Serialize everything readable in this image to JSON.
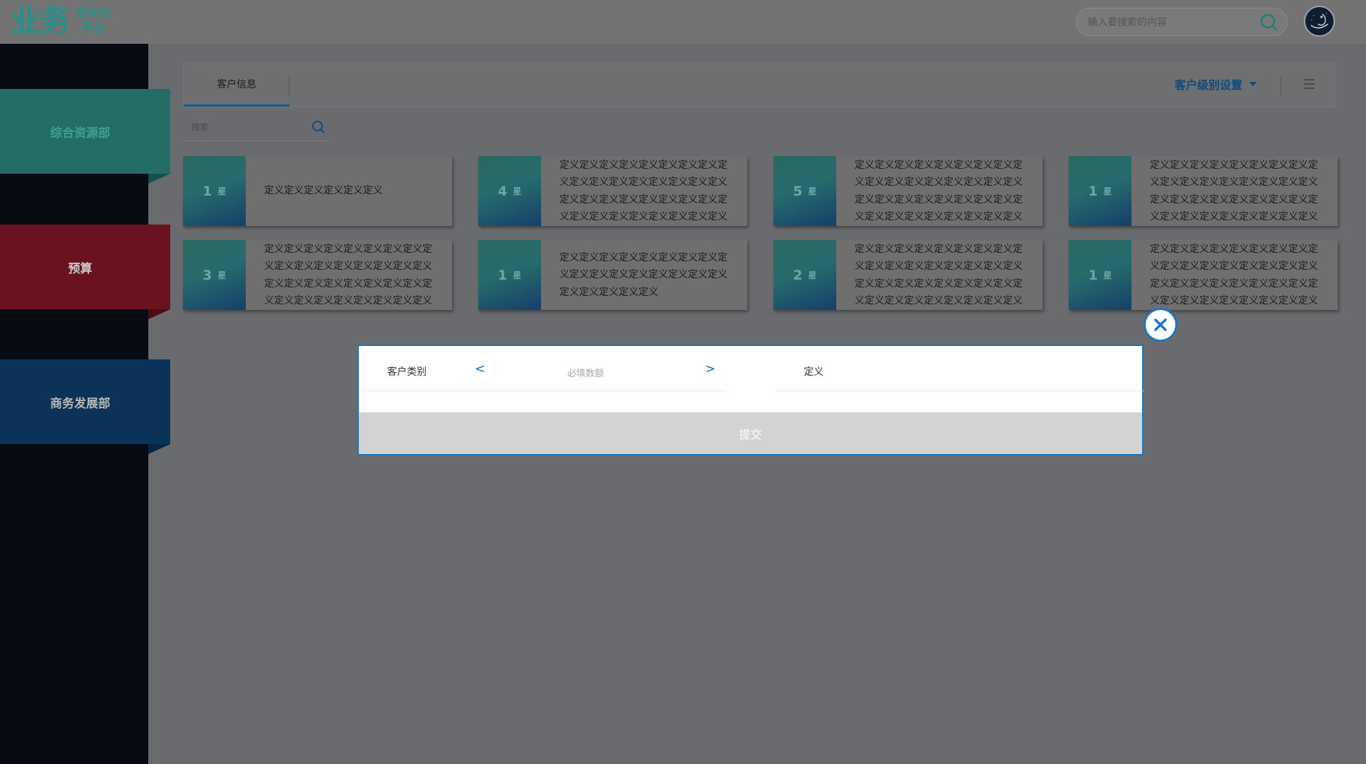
{
  "header": {
    "logo_main": "业务",
    "logo_sub_line1": "市场化",
    "logo_sub_line2": "平台",
    "search_placeholder": "输入要搜索的内容",
    "search_icon": "search-icon",
    "avatar_icon": "user-avatar"
  },
  "sidebar": {
    "items": [
      {
        "label": "综合资源部",
        "color": "#226e67"
      },
      {
        "label": "预算",
        "color": "#6b1221"
      },
      {
        "label": "商务发展部",
        "color": "#0b3358"
      }
    ]
  },
  "panel": {
    "tab_label": "客户信息",
    "level_settings_label": "客户级别设置",
    "menu_icon": "hamburger-menu-icon",
    "search_placeholder": "搜索",
    "accent_color": "#0f5a8e"
  },
  "cards": [
    {
      "stars": "1",
      "unit": "星",
      "text": "定义定义定义定义定义定义"
    },
    {
      "stars": "4",
      "unit": "星",
      "text": "定义定义定义定义定义定义定义定义定义定义定义定义定义定义定义定义定义定义定义定义定义定义定义定义定义定义定义定义定义定义定义定义定义定义定义定义定义定义定义定义定义定义定义定义定义定义定义定义定义定义定义定义定义定义定义定义定义定义定义定义定义定义定义定义定义"
    },
    {
      "stars": "5",
      "unit": "星",
      "text": "定义定义定义定义定义定义定义定义定义定义定义定义定义定义定义定义定义定义定义定义定义定义定义定义定义定义定义定义定义定义定义定义定义定义定义定义定义定义定义定义定义定义定义定义定义定义定义定义定义定义定义定义定义定义定义定义定义定义定义定义定义定义定义定义定义"
    },
    {
      "stars": "1",
      "unit": "星",
      "text": "定义定义定义定义定义定义定义定义定义定义定义定义定义定义定义定义定义定义定义定义定义定义定义定义定义定义定义定义定义定义定义定义定义定义定义定义定义定义定义定义定义定义定义定义定义定义定义定义定义定义定义定义定义定义定义定义定义定义定义定义定义定义定义定义定义"
    },
    {
      "stars": "3",
      "unit": "星",
      "text": "定义定义定义定义定义定义定义定义定义定义定义定义定义定义定义定义定义定义定义定义定义定义定义定义定义定义定义定义定义定义定义定义定义定义定义定义定义定义定义定义定义定义定义定义定义定义定义定义定义定义定义定义定义定义定义定义定义定义定义定义定义定义定义定义定义"
    },
    {
      "stars": "1",
      "unit": "星",
      "text": "定义定义定义定义定义定义定义定义定义定义定义定义定义定义定义定义定义定义定义定义定义定义"
    },
    {
      "stars": "2",
      "unit": "星",
      "text": "定义定义定义定义定义定义定义定义定义定义定义定义定义定义定义定义定义定义定义定义定义定义定义定义定义定义定义定义定义定义定义定义定义定义定义定义定义定义定义定义定义定义定义定义定义定义定义定义定义定义定义定义定义定义定义定义定义定义定义定义定义定义定义定义定义"
    },
    {
      "stars": "1",
      "unit": "星",
      "text": "定义定义定义定义定义定义定义定义定义定义定义定义定义定义定义定义定义定义定义定义定义定义定义定义定义定义定义定义定义定义定义定义定义定义定义定义定义定义定义定义定义定义定义定义定义定义定义定义定义定义定义定义定义定义定义定义定义定义定义定义定义定义定义定义定义"
    }
  ],
  "modal": {
    "customer_type_label": "客户类别",
    "prev_arrow": "<",
    "next_arrow": ">",
    "amount_placeholder": "必填数额",
    "definition_label": "定义",
    "submit_label": "提交",
    "close_icon": "close-circle-icon",
    "border_color": "#1d75c2"
  }
}
